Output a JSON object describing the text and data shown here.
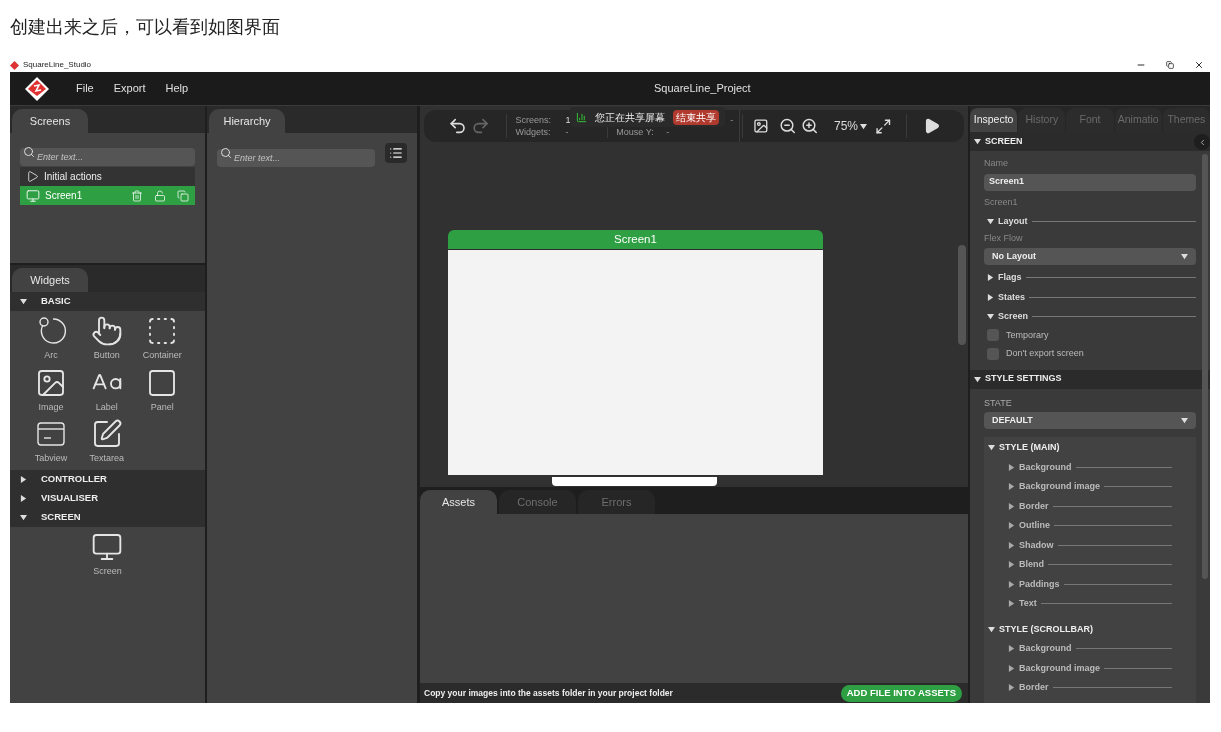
{
  "caption": "创建出来之后，可以看到如图界面",
  "window": {
    "title": "SquareLine_Studio",
    "project": "SquareLine_Project"
  },
  "menu": [
    "File",
    "Export",
    "Help"
  ],
  "screens_panel": {
    "tab": "Screens",
    "search_placeholder": "Enter text...",
    "items": [
      {
        "kind": "actions",
        "label": "Initial actions",
        "selected": false
      },
      {
        "kind": "screen",
        "label": "Screen1",
        "selected": true
      }
    ]
  },
  "hierarchy_panel": {
    "tab": "Hierarchy",
    "search_placeholder": "Enter text..."
  },
  "widgets_panel": {
    "tab": "Widgets",
    "groups": [
      {
        "label": "BASIC",
        "expanded": true,
        "items": [
          {
            "kind": "arc",
            "label": "Arc"
          },
          {
            "kind": "button",
            "label": "Button"
          },
          {
            "kind": "container",
            "label": "Container"
          },
          {
            "kind": "image",
            "label": "Image"
          },
          {
            "kind": "label",
            "label": "Label"
          },
          {
            "kind": "panel",
            "label": "Panel"
          },
          {
            "kind": "tabview",
            "label": "Tabview"
          },
          {
            "kind": "textarea",
            "label": "Textarea"
          }
        ]
      },
      {
        "label": "CONTROLLER",
        "expanded": false
      },
      {
        "label": "VISUALISER",
        "expanded": false
      },
      {
        "label": "SCREEN",
        "expanded": true,
        "items": [
          {
            "kind": "screen",
            "label": "Screen"
          }
        ]
      }
    ]
  },
  "toolbar": {
    "stat_columns": [
      [
        {
          "label": "Screens:",
          "value": "1"
        },
        {
          "label": "Widgets:",
          "value": "-"
        }
      ],
      [
        {
          "value": "-"
        },
        {
          "label": "Mouse Y:",
          "value": "-"
        }
      ]
    ],
    "zoom": "75%"
  },
  "share_banner": {
    "text": "您正在共享屏幕",
    "button": "结束共享"
  },
  "canvas": {
    "screen_title": "Screen1"
  },
  "bottom_panel": {
    "tabs": [
      {
        "label": "Assets",
        "selected": true
      },
      {
        "label": "Console",
        "selected": false
      },
      {
        "label": "Errors",
        "selected": false
      }
    ],
    "hint": "Copy your images into the assets folder in your project folder",
    "button": "ADD FILE INTO ASSETS"
  },
  "inspector": {
    "tabs": [
      {
        "label": "Inspecto",
        "selected": true
      },
      {
        "label": "History",
        "selected": false
      },
      {
        "label": "Font",
        "selected": false
      },
      {
        "label": "Animatio",
        "selected": false
      },
      {
        "label": "Themes",
        "selected": false
      }
    ],
    "screen_section": {
      "title": "SCREEN",
      "expanded": true,
      "name_label": "Name",
      "name_value": "Screen1",
      "subtitle": "Screen1",
      "groups": [
        {
          "title": "Layout",
          "expanded": true,
          "field_label": "Flex Flow",
          "dropdown": "No Layout"
        },
        {
          "title": "Flags",
          "expanded": false
        },
        {
          "title": "States",
          "expanded": false
        },
        {
          "title": "Screen",
          "expanded": true,
          "checkboxes": [
            {
              "label": "Temporary",
              "checked": false
            },
            {
              "label": "Don't export screen",
              "checked": false
            }
          ]
        }
      ]
    },
    "style_section": {
      "title": "STYLE SETTINGS",
      "expanded": true,
      "state_label": "STATE",
      "state_value": "DEFAULT",
      "styles": [
        {
          "title": "STYLE (MAIN)",
          "expanded": true,
          "items": [
            {
              "label": "Background",
              "expanded": false
            },
            {
              "label": "Background image",
              "expanded": false
            },
            {
              "label": "Border",
              "expanded": false
            },
            {
              "label": "Outline",
              "expanded": false
            },
            {
              "label": "Shadow",
              "expanded": false
            },
            {
              "label": "Blend",
              "expanded": false
            },
            {
              "label": "Paddings",
              "expanded": false
            },
            {
              "label": "Text",
              "expanded": false
            }
          ]
        },
        {
          "title": "STYLE (SCROLLBAR)",
          "expanded": true,
          "items": [
            {
              "label": "Background",
              "expanded": false
            },
            {
              "label": "Background image",
              "expanded": false
            },
            {
              "label": "Border",
              "expanded": false
            }
          ]
        }
      ]
    }
  }
}
